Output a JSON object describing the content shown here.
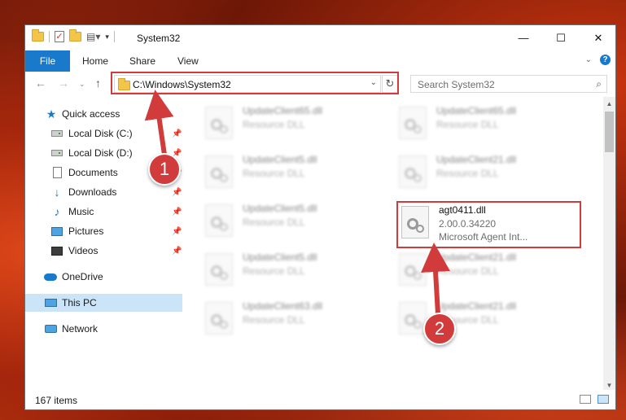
{
  "window": {
    "title": "System32"
  },
  "ribbon": {
    "file": "File",
    "home": "Home",
    "share": "Share",
    "view": "View"
  },
  "address": {
    "path": "C:\\Windows\\System32"
  },
  "search": {
    "placeholder": "Search System32"
  },
  "sidebar": {
    "items": [
      {
        "label": "Quick access",
        "icon": "star-icon"
      },
      {
        "label": "Local Disk (C:)",
        "icon": "drive-icon"
      },
      {
        "label": "Local Disk (D:)",
        "icon": "drive-icon"
      },
      {
        "label": "Documents",
        "icon": "documents-icon"
      },
      {
        "label": "Downloads",
        "icon": "downloads-icon"
      },
      {
        "label": "Music",
        "icon": "music-icon"
      },
      {
        "label": "Pictures",
        "icon": "pictures-icon"
      },
      {
        "label": "Videos",
        "icon": "videos-icon"
      },
      {
        "label": "OneDrive",
        "icon": "cloud-icon"
      },
      {
        "label": "This PC",
        "icon": "pc-icon"
      },
      {
        "label": "Network",
        "icon": "network-icon"
      }
    ]
  },
  "files": [
    {
      "name": "UpdateClient65.dll",
      "type": "Resource DLL"
    },
    {
      "name": "UpdateClient65.dll",
      "type": "Resource DLL"
    },
    {
      "name": "UpdateClient5.dll",
      "type": "Resource DLL"
    },
    {
      "name": "UpdateClient21.dll",
      "type": "Resource DLL"
    },
    {
      "name": "UpdateClient5.dll",
      "type": "Resource DLL"
    },
    {
      "name": "agt0411.dll",
      "version": "2.00.0.34220",
      "description": "Microsoft Agent Int..."
    },
    {
      "name": "UpdateClient5.dll",
      "type": "Resource DLL"
    },
    {
      "name": "UpdateClient21.dll",
      "type": "Resource DLL"
    },
    {
      "name": "UpdateClient63.dll",
      "type": "Resource DLL"
    },
    {
      "name": "UpdateClient21.dll",
      "type": "Resource DLL"
    }
  ],
  "status": {
    "items": "167 items"
  },
  "annotations": {
    "badge1": "1",
    "badge2": "2"
  },
  "colors": {
    "accent": "#1979ca",
    "highlight": "#d23b3b",
    "selected": "#cce4f7"
  }
}
